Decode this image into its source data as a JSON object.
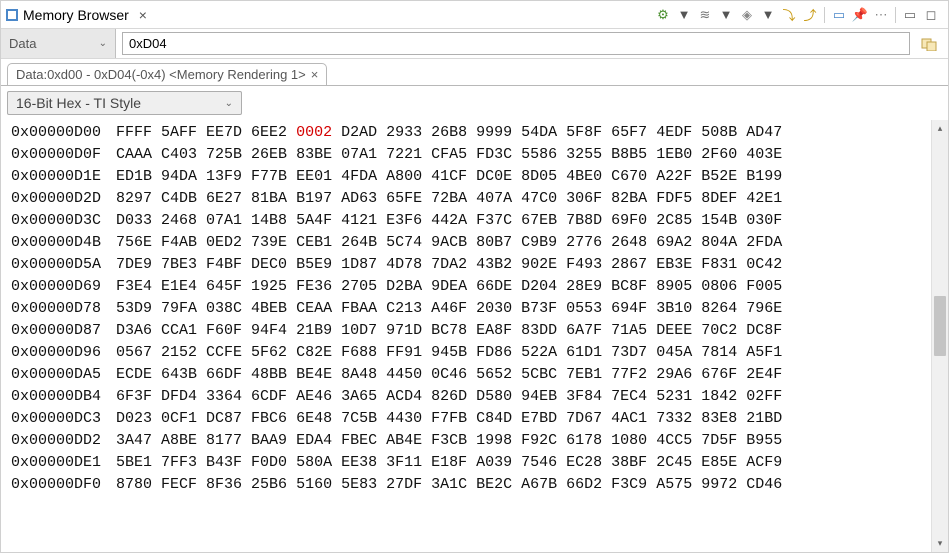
{
  "title_bar": {
    "title": "Memory Browser",
    "close_x": "×"
  },
  "toolbar": {
    "icons": [
      {
        "name": "chip-icon",
        "glyph": "⚙",
        "color": "#4a8f2f"
      },
      {
        "name": "dropdown-arrow-icon",
        "glyph": "▼",
        "color": "#555"
      },
      {
        "name": "wave-icon",
        "glyph": "≋",
        "color": "#777"
      },
      {
        "name": "dropdown-arrow-icon",
        "glyph": "▼",
        "color": "#555"
      },
      {
        "name": "diamond-icon",
        "glyph": "◈",
        "color": "#888"
      },
      {
        "name": "dropdown-arrow-icon",
        "glyph": "▼",
        "color": "#555"
      },
      {
        "name": "load-icon",
        "glyph": "⤵",
        "color": "#c99a12"
      },
      {
        "name": "save-icon",
        "glyph": "⤴",
        "color": "#c99a12"
      },
      {
        "name": "new-tab-icon",
        "glyph": "▭",
        "color": "#4a87c9"
      },
      {
        "name": "pin-icon",
        "glyph": "📌",
        "color": "#4a87c9"
      },
      {
        "name": "menu-icon",
        "glyph": "⋯",
        "color": "#888"
      },
      {
        "name": "minimize-icon",
        "glyph": "▭",
        "color": "#666"
      },
      {
        "name": "maximize-icon",
        "glyph": "◻",
        "color": "#666"
      }
    ]
  },
  "location": {
    "dropdown_label": "Data",
    "address_value": "0xD04"
  },
  "tab": {
    "label": "Data:0xd00 - 0xD04(-0x4) <Memory Rendering 1>",
    "close_x": "×"
  },
  "format_dropdown": {
    "label": "16-Bit Hex - TI Style"
  },
  "memory": {
    "highlight_row": 0,
    "highlight_col": 4,
    "rows": [
      {
        "addr": "0x00000D00",
        "words": [
          "FFFF",
          "5AFF",
          "EE7D",
          "6EE2",
          "0002",
          "D2AD",
          "2933",
          "26B8",
          "9999",
          "54DA",
          "5F8F",
          "65F7",
          "4EDF",
          "508B",
          "AD47"
        ]
      },
      {
        "addr": "0x00000D0F",
        "words": [
          "CAAA",
          "C403",
          "725B",
          "26EB",
          "83BE",
          "07A1",
          "7221",
          "CFA5",
          "FD3C",
          "5586",
          "3255",
          "B8B5",
          "1EB0",
          "2F60",
          "403E"
        ]
      },
      {
        "addr": "0x00000D1E",
        "words": [
          "ED1B",
          "94DA",
          "13F9",
          "F77B",
          "EE01",
          "4FDA",
          "A800",
          "41CF",
          "DC0E",
          "8D05",
          "4BE0",
          "C670",
          "A22F",
          "B52E",
          "B199"
        ]
      },
      {
        "addr": "0x00000D2D",
        "words": [
          "8297",
          "C4DB",
          "6E27",
          "81BA",
          "B197",
          "AD63",
          "65FE",
          "72BA",
          "407A",
          "47C0",
          "306F",
          "82BA",
          "FDF5",
          "8DEF",
          "42E1"
        ]
      },
      {
        "addr": "0x00000D3C",
        "words": [
          "D033",
          "2468",
          "07A1",
          "14B8",
          "5A4F",
          "4121",
          "E3F6",
          "442A",
          "F37C",
          "67EB",
          "7B8D",
          "69F0",
          "2C85",
          "154B",
          "030F"
        ]
      },
      {
        "addr": "0x00000D4B",
        "words": [
          "756E",
          "F4AB",
          "0ED2",
          "739E",
          "CEB1",
          "264B",
          "5C74",
          "9ACB",
          "80B7",
          "C9B9",
          "2776",
          "2648",
          "69A2",
          "804A",
          "2FDA"
        ]
      },
      {
        "addr": "0x00000D5A",
        "words": [
          "7DE9",
          "7BE3",
          "F4BF",
          "DEC0",
          "B5E9",
          "1D87",
          "4D78",
          "7DA2",
          "43B2",
          "902E",
          "F493",
          "2867",
          "EB3E",
          "F831",
          "0C42"
        ]
      },
      {
        "addr": "0x00000D69",
        "words": [
          "F3E4",
          "E1E4",
          "645F",
          "1925",
          "FE36",
          "2705",
          "D2BA",
          "9DEA",
          "66DE",
          "D204",
          "28E9",
          "BC8F",
          "8905",
          "0806",
          "F005"
        ]
      },
      {
        "addr": "0x00000D78",
        "words": [
          "53D9",
          "79FA",
          "038C",
          "4BEB",
          "CEAA",
          "FBAA",
          "C213",
          "A46F",
          "2030",
          "B73F",
          "0553",
          "694F",
          "3B10",
          "8264",
          "796E"
        ]
      },
      {
        "addr": "0x00000D87",
        "words": [
          "D3A6",
          "CCA1",
          "F60F",
          "94F4",
          "21B9",
          "10D7",
          "971D",
          "BC78",
          "EA8F",
          "83DD",
          "6A7F",
          "71A5",
          "DEEE",
          "70C2",
          "DC8F"
        ]
      },
      {
        "addr": "0x00000D96",
        "words": [
          "0567",
          "2152",
          "CCFE",
          "5F62",
          "C82E",
          "F688",
          "FF91",
          "945B",
          "FD86",
          "522A",
          "61D1",
          "73D7",
          "045A",
          "7814",
          "A5F1"
        ]
      },
      {
        "addr": "0x00000DA5",
        "words": [
          "ECDE",
          "643B",
          "66DF",
          "48BB",
          "BE4E",
          "8A48",
          "4450",
          "0C46",
          "5652",
          "5CBC",
          "7EB1",
          "77F2",
          "29A6",
          "676F",
          "2E4F"
        ]
      },
      {
        "addr": "0x00000DB4",
        "words": [
          "6F3F",
          "DFD4",
          "3364",
          "6CDF",
          "AE46",
          "3A65",
          "ACD4",
          "826D",
          "D580",
          "94EB",
          "3F84",
          "7EC4",
          "5231",
          "1842",
          "02FF"
        ]
      },
      {
        "addr": "0x00000DC3",
        "words": [
          "D023",
          "0CF1",
          "DC87",
          "FBC6",
          "6E48",
          "7C5B",
          "4430",
          "F7FB",
          "C84D",
          "E7BD",
          "7D67",
          "4AC1",
          "7332",
          "83E8",
          "21BD"
        ]
      },
      {
        "addr": "0x00000DD2",
        "words": [
          "3A47",
          "A8BE",
          "8177",
          "BAA9",
          "EDA4",
          "FBEC",
          "AB4E",
          "F3CB",
          "1998",
          "F92C",
          "6178",
          "1080",
          "4CC5",
          "7D5F",
          "B955"
        ]
      },
      {
        "addr": "0x00000DE1",
        "words": [
          "5BE1",
          "7FF3",
          "B43F",
          "F0D0",
          "580A",
          "EE38",
          "3F11",
          "E18F",
          "A039",
          "7546",
          "EC28",
          "38BF",
          "2C45",
          "E85E",
          "ACF9"
        ]
      },
      {
        "addr": "0x00000DF0",
        "words": [
          "8780",
          "FECF",
          "8F36",
          "25B6",
          "5160",
          "5E83",
          "27DF",
          "3A1C",
          "BE2C",
          "A67B",
          "66D2",
          "F3C9",
          "A575",
          "9972",
          "CD46"
        ]
      }
    ]
  }
}
